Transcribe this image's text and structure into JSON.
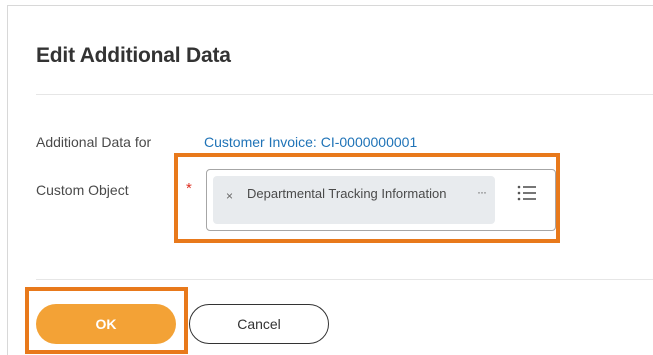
{
  "dialog": {
    "title": "Edit Additional Data",
    "additional_data_label": "Additional Data for",
    "additional_data_value": "Customer Invoice: CI-0000000001",
    "custom_object_label": "Custom Object",
    "required_marker": "*",
    "selected_item": {
      "remove_glyph": "×",
      "text": "Departmental Tracking Information",
      "more_glyph": "···"
    },
    "list_icon": "list-icon"
  },
  "buttons": {
    "ok_label": "OK",
    "cancel_label": "Cancel"
  },
  "colors": {
    "highlight": "#e8791b",
    "ok_button": "#f3a236",
    "link": "#1f73b7",
    "required": "#de2e21"
  }
}
